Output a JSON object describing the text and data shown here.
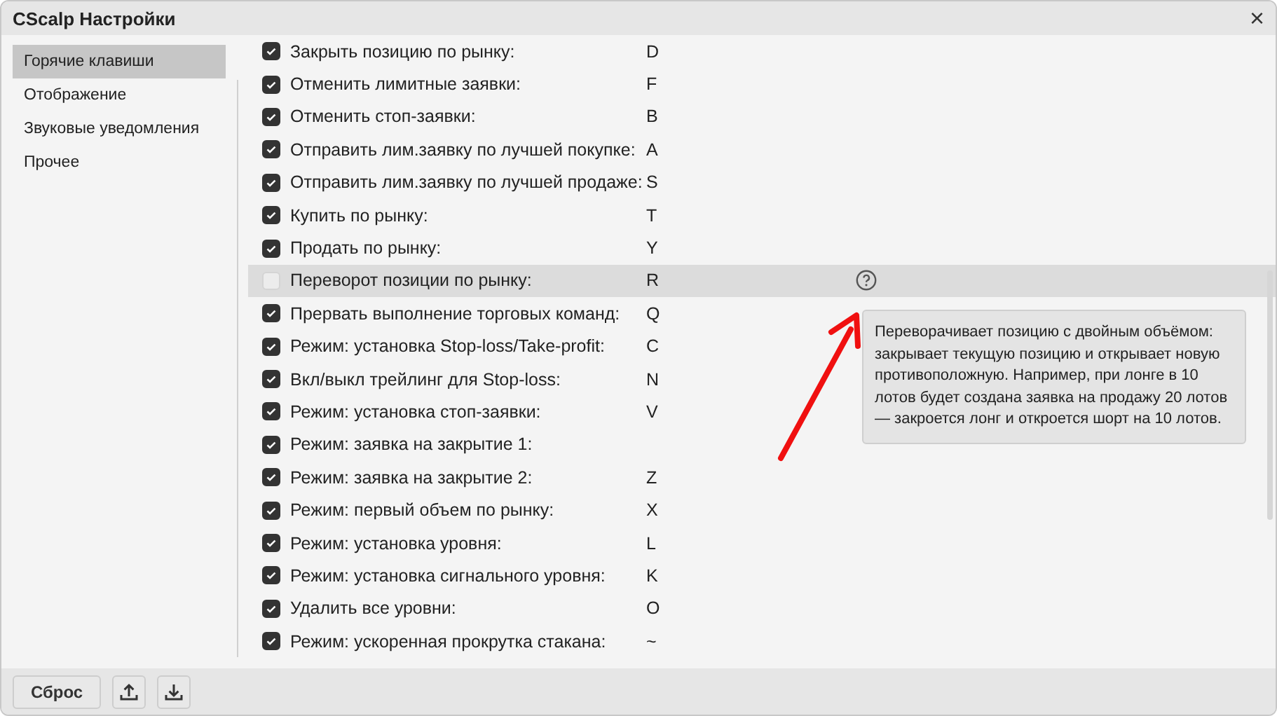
{
  "window": {
    "title": "CScalp Настройки",
    "close": "×"
  },
  "sidebar": {
    "items": [
      {
        "label": "Горячие клавиши",
        "selected": true
      },
      {
        "label": "Отображение",
        "selected": false
      },
      {
        "label": "Звуковые уведомления",
        "selected": false
      },
      {
        "label": "Прочее",
        "selected": false
      }
    ]
  },
  "hotkeys": [
    {
      "label": "Закрыть позицию по рынку:",
      "key": "D",
      "checked": true,
      "highlighted": false
    },
    {
      "label": "Отменить лимитные заявки:",
      "key": "F",
      "checked": true,
      "highlighted": false
    },
    {
      "label": "Отменить стоп-заявки:",
      "key": "B",
      "checked": true,
      "highlighted": false
    },
    {
      "label": "Отправить лим.заявку по лучшей покупке:",
      "key": "A",
      "checked": true,
      "highlighted": false
    },
    {
      "label": "Отправить лим.заявку по лучшей продаже:",
      "key": "S",
      "checked": true,
      "highlighted": false
    },
    {
      "label": "Купить по рынку:",
      "key": "T",
      "checked": true,
      "highlighted": false
    },
    {
      "label": "Продать по рынку:",
      "key": "Y",
      "checked": true,
      "highlighted": false
    },
    {
      "label": "Переворот позиции по рынку:",
      "key": "R",
      "checked": false,
      "highlighted": true
    },
    {
      "label": "Прервать выполнение торговых команд:",
      "key": "Q",
      "checked": true,
      "highlighted": false
    },
    {
      "label": "Режим: установка Stop-loss/Take-profit:",
      "key": "C",
      "checked": true,
      "highlighted": false
    },
    {
      "label": "Вкл/выкл трейлинг для Stop-loss:",
      "key": "N",
      "checked": true,
      "highlighted": false
    },
    {
      "label": "Режим: установка стоп-заявки:",
      "key": "V",
      "checked": true,
      "highlighted": false
    },
    {
      "label": "Режим: заявка на закрытие 1:",
      "checked": true,
      "highlighted": false
    },
    {
      "label": "Режим: заявка на закрытие 2:",
      "key": "Z",
      "checked": true,
      "highlighted": false
    },
    {
      "label": "Режим: первый объем по рынку:",
      "key": "X",
      "checked": true,
      "highlighted": false
    },
    {
      "label": "Режим: установка уровня:",
      "key": "L",
      "checked": true,
      "highlighted": false
    },
    {
      "label": "Режим: установка сигнального уровня:",
      "key": "K",
      "checked": true,
      "highlighted": false
    },
    {
      "label": "Удалить все уровни:",
      "key": "O",
      "checked": true,
      "highlighted": false
    },
    {
      "label": "Режим: ускоренная прокрутка стакана:",
      "key": "~",
      "checked": true,
      "highlighted": false
    }
  ],
  "tooltip": {
    "text": "Переворачивает позицию с двойным объёмом: закрывает текущую позицию и открывает новую противоположную. Например, при лонге в 10 лотов будет создана заявка на продажу 20 лотов — закроется лонг и откроется шорт на 10 лотов."
  },
  "footer": {
    "reset_button": "Сброс"
  }
}
